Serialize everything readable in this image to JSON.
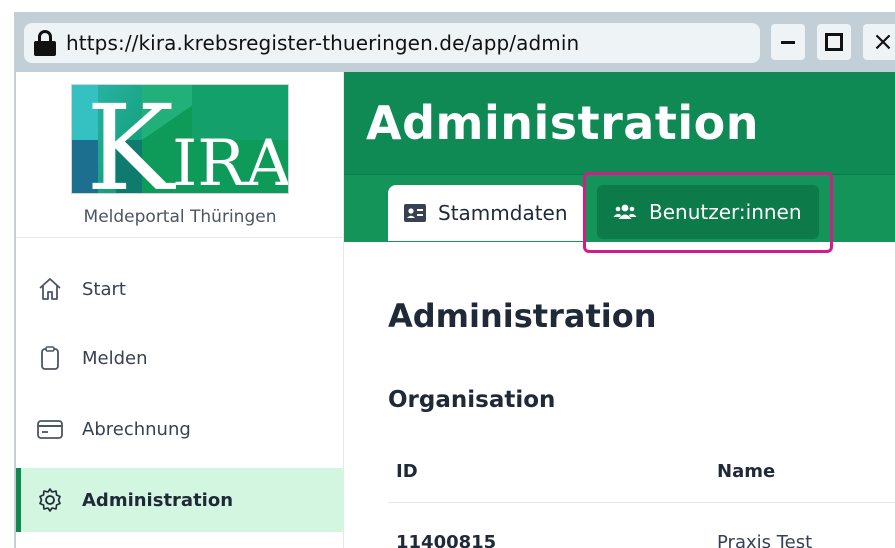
{
  "browser": {
    "url": "https://kira.krebsregister-thueringen.de/app/admin",
    "lock_icon": "lock-icon",
    "minimize_icon": "minimize-icon",
    "maximize_icon": "maximize-icon",
    "close_glyph": "×"
  },
  "sidebar": {
    "logo_text_k": "K",
    "logo_text_ira": "IRA",
    "subtitle": "Meldeportal Thüringen",
    "items": [
      {
        "label": "Start",
        "icon": "home-icon",
        "active": false
      },
      {
        "label": "Melden",
        "icon": "clipboard-icon",
        "active": false
      },
      {
        "label": "Abrechnung",
        "icon": "credit-card-icon",
        "active": false
      },
      {
        "label": "Administration",
        "icon": "gear-icon",
        "active": true
      }
    ]
  },
  "header": {
    "title": "Administration",
    "tabs": [
      {
        "label": "Stammdaten",
        "icon": "id-card-icon",
        "selected": true
      },
      {
        "label": "Benutzer:innen",
        "icon": "users-icon",
        "selected": false,
        "highlighted": true
      }
    ]
  },
  "content": {
    "page_title": "Administration",
    "section_title": "Organisation",
    "table": {
      "columns": [
        "ID",
        "Name"
      ],
      "rows": [
        [
          "11400815",
          "Praxis Test"
        ]
      ]
    }
  },
  "colors": {
    "brand_green": "#0f8a54",
    "active_nav_bg": "#d3f6e1",
    "highlight": "#d11d8a"
  }
}
